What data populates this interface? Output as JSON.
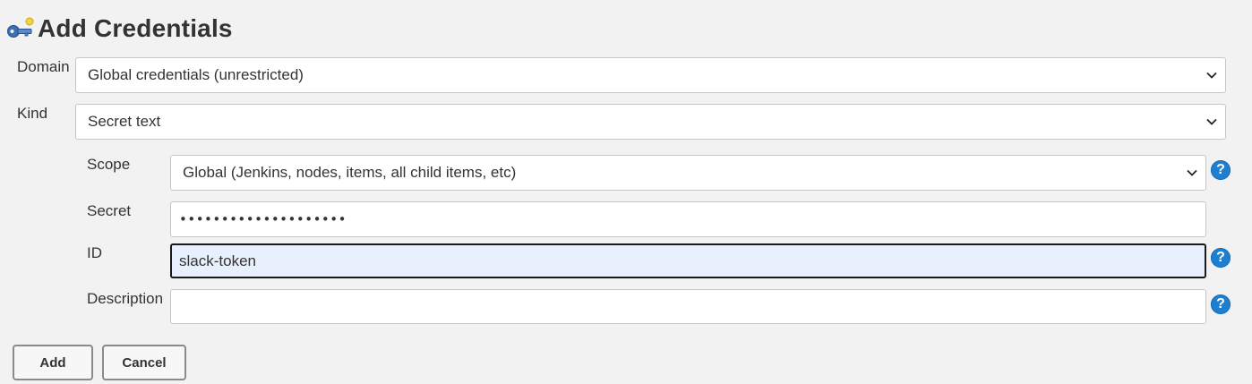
{
  "page": {
    "title": "Add Credentials",
    "icon": "key-icon"
  },
  "form": {
    "domain": {
      "label": "Domain",
      "value": "Global credentials (unrestricted)"
    },
    "kind": {
      "label": "Kind",
      "value": "Secret text"
    },
    "scope": {
      "label": "Scope",
      "value": "Global (Jenkins, nodes, items, all child items, etc)"
    },
    "secret": {
      "label": "Secret",
      "value": "••••••••••••••••••••"
    },
    "id": {
      "label": "ID",
      "value": "slack-token"
    },
    "description": {
      "label": "Description",
      "value": ""
    }
  },
  "help": {
    "glyph": "?"
  },
  "buttons": {
    "add_label": "Add",
    "cancel_label": "Cancel"
  },
  "colors": {
    "background": "#f2f2f2",
    "help_icon": "#1e7fd1",
    "focused_field": "#e8f0fe"
  }
}
